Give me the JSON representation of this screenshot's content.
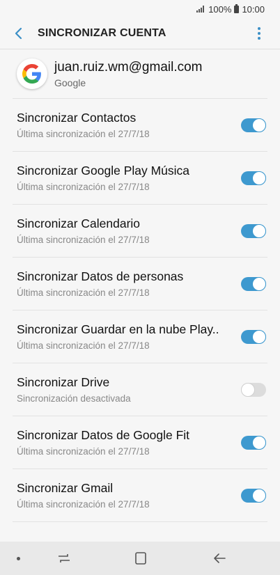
{
  "status": {
    "battery_percent": "100%",
    "time": "10:00"
  },
  "header": {
    "title": "SINCRONIZAR CUENTA"
  },
  "account": {
    "email": "juan.ruiz.wm@gmail.com",
    "type": "Google"
  },
  "items": [
    {
      "title": "Sincronizar Contactos",
      "subtitle": "Última sincronización el 27/7/18",
      "enabled": true
    },
    {
      "title": "Sincronizar Google Play Música",
      "subtitle": "Última sincronización el 27/7/18",
      "enabled": true
    },
    {
      "title": "Sincronizar Calendario",
      "subtitle": "Última sincronización el 27/7/18",
      "enabled": true
    },
    {
      "title": "Sincronizar Datos de personas",
      "subtitle": "Última sincronización el 27/7/18",
      "enabled": true
    },
    {
      "title": "Sincronizar Guardar en la nube Play..",
      "subtitle": "Última sincronización el 27/7/18",
      "enabled": true
    },
    {
      "title": "Sincronizar Drive",
      "subtitle": "Sincronización desactivada",
      "enabled": false
    },
    {
      "title": "Sincronizar Datos de Google Fit",
      "subtitle": "Última sincronización el 27/7/18",
      "enabled": true
    },
    {
      "title": "Sincronizar Gmail",
      "subtitle": "Última sincronización el 27/7/18",
      "enabled": true
    }
  ],
  "colors": {
    "accent": "#3e99cf",
    "toggle_off": "#dcdcdc",
    "background": "#f6f6f6"
  },
  "icons": {
    "back": "chevron-left-icon",
    "more": "more-vertical-icon",
    "account": "google-logo-icon"
  }
}
